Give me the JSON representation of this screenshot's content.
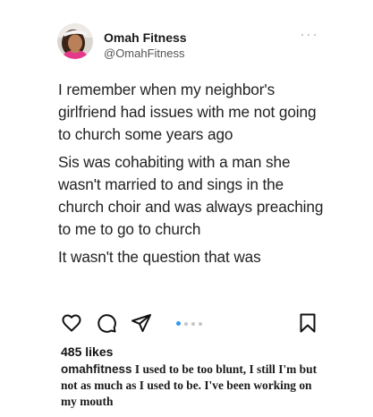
{
  "post": {
    "author": {
      "display_name": "Omah Fitness",
      "handle": "@OmahFitness",
      "avatar_icon": "profile-photo-avatar"
    },
    "more_icon": "more-dots-icon",
    "tweet_paragraphs": [
      "I remember when my neighbor's girlfriend had issues with me not going to church some years ago",
      "Sis was cohabiting with a man she wasn't married to and sings in the church choir and was always preaching to me to go to church",
      "It wasn't the question that was"
    ]
  },
  "actions": {
    "like_icon": "heart-icon",
    "comment_icon": "comment-bubble-icon",
    "share_icon": "send-arrow-icon",
    "save_icon": "bookmark-icon",
    "carousel_dots": 4,
    "carousel_active_index": 0,
    "accent_color": "#3897f0"
  },
  "likes": {
    "text": "485 likes"
  },
  "caption": {
    "username": "omahfitness",
    "text": "I used to be too blunt, I still I'm but not as much as I used to be. I've been working on my mouth"
  }
}
